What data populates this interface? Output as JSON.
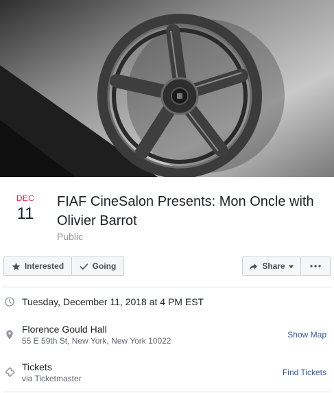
{
  "event": {
    "month": "DEC",
    "day": "11",
    "title": "FIAF CineSalon Presents: Mon Oncle with Olivier Barrot",
    "privacy": "Public"
  },
  "actions": {
    "interested_label": "Interested",
    "going_label": "Going",
    "share_label": "Share"
  },
  "details": {
    "datetime": "Tuesday, December 11, 2018 at 4 PM EST",
    "venue_name": "Florence Gould Hall",
    "venue_address": "55 E 59th St, New York, New York 10022",
    "show_map_label": "Show Map",
    "tickets_label": "Tickets",
    "tickets_source": "via Ticketmaster",
    "find_tickets_label": "Find Tickets"
  },
  "icons": {
    "interested": "star-icon",
    "going": "checkmark-icon",
    "share": "share-arrow-icon",
    "share_menu": "caret-down-icon",
    "more": "more-dots-icon",
    "datetime": "clock-icon",
    "location": "map-pin-icon",
    "tickets": "ticket-icon"
  },
  "colors": {
    "month": "#f02849",
    "link": "#365899",
    "muted_text": "#90949c",
    "button_bg": "#f5f6f7"
  }
}
